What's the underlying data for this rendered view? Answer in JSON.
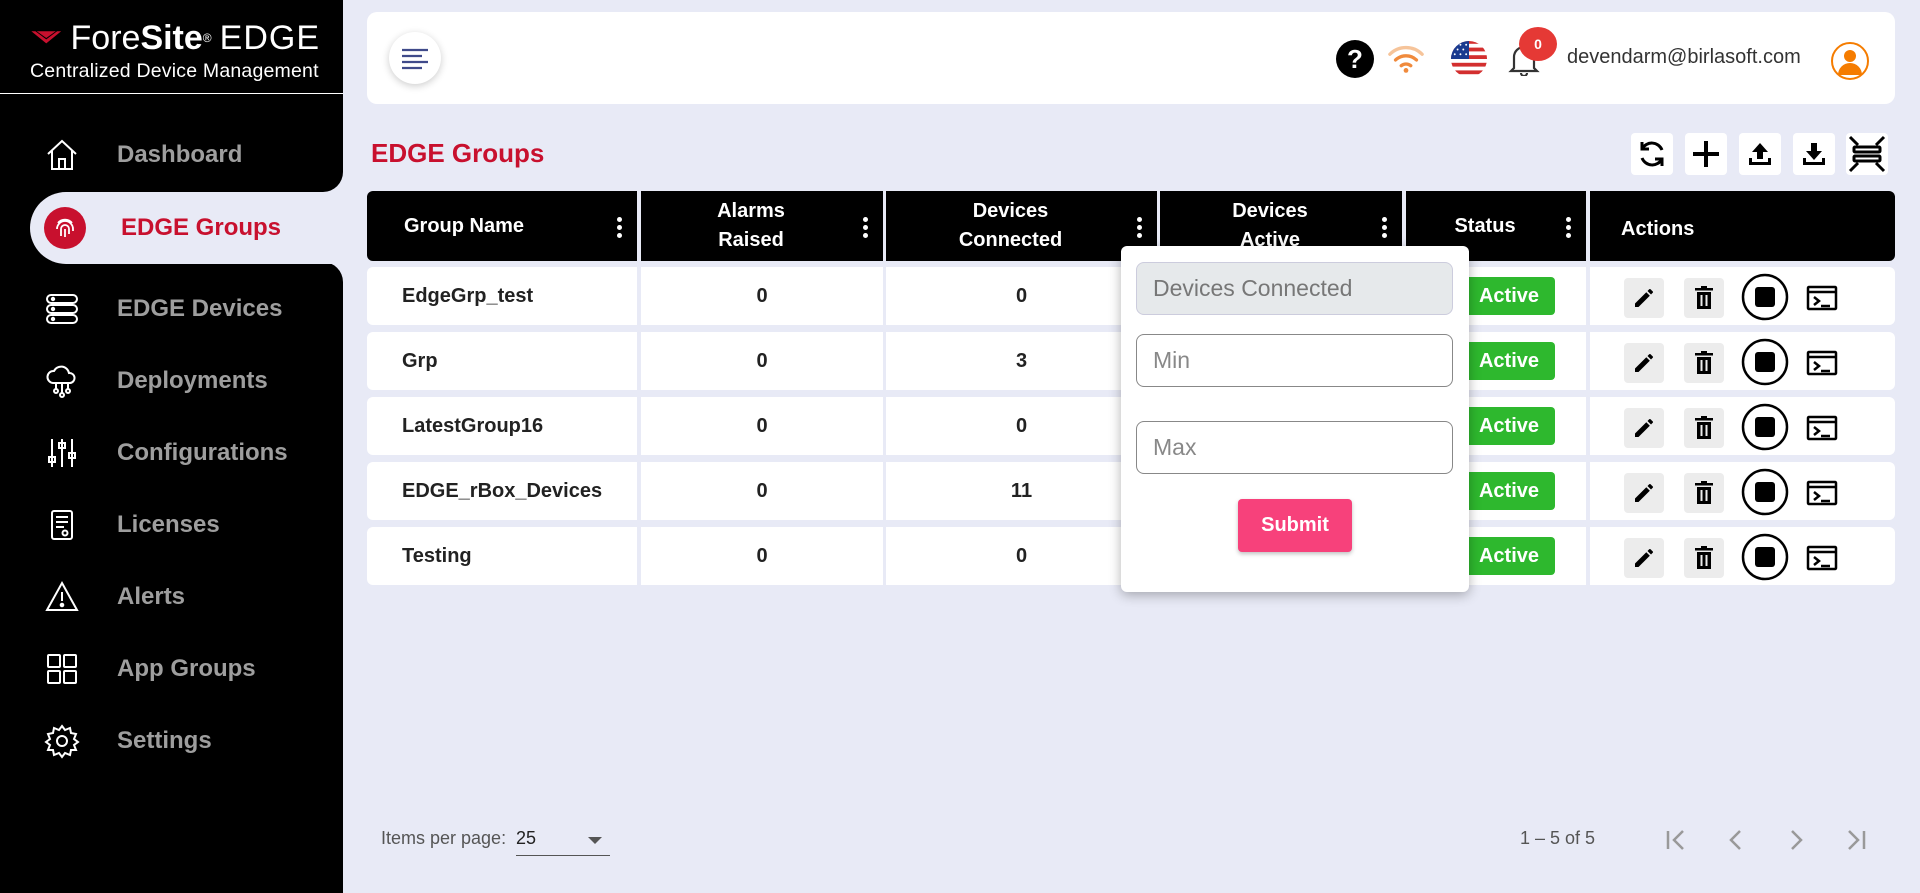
{
  "brand": {
    "name_part1": "Fore",
    "name_part2": "Site",
    "registered": "®",
    "name_part3": "EDGE",
    "subtitle": "Centralized Device Management",
    "accent_color": "#c8102e"
  },
  "sidebar": {
    "items": [
      {
        "label": "Dashboard",
        "icon": "home-icon"
      },
      {
        "label": "EDGE Groups",
        "icon": "fingerprint-icon",
        "active": true
      },
      {
        "label": "EDGE Devices",
        "icon": "server-icon"
      },
      {
        "label": "Deployments",
        "icon": "cloud-network-icon"
      },
      {
        "label": "Configurations",
        "icon": "sliders-icon"
      },
      {
        "label": "Licenses",
        "icon": "license-icon"
      },
      {
        "label": "Alerts",
        "icon": "warning-icon"
      },
      {
        "label": "App Groups",
        "icon": "grid-icon"
      },
      {
        "label": "Settings",
        "icon": "gear-icon"
      }
    ]
  },
  "header": {
    "help": "?",
    "notification_count": "0",
    "user_email": "devendarm@birlasoft.com"
  },
  "page": {
    "title": "EDGE Groups"
  },
  "toolbar": [
    "refresh-icon",
    "add-icon",
    "upload-icon",
    "download-icon",
    "collapse-icon"
  ],
  "table": {
    "columns": [
      "Group Name",
      "Alarms Raised",
      "Devices Connected",
      "Devices Active",
      "Status",
      "Actions"
    ],
    "column_lines": {
      "alarms": [
        "Alarms",
        "Raised"
      ],
      "connected": [
        "Devices",
        "Connected"
      ],
      "active": [
        "Devices",
        "Active"
      ]
    },
    "rows": [
      {
        "name": "EdgeGrp_test",
        "alarms": "0",
        "connected": "0",
        "status": "Active"
      },
      {
        "name": "Grp",
        "alarms": "0",
        "connected": "3",
        "status": "Active"
      },
      {
        "name": "LatestGroup16",
        "alarms": "0",
        "connected": "0",
        "status": "Active"
      },
      {
        "name": "EDGE_rBox_Devices",
        "alarms": "0",
        "connected": "11",
        "status": "Active"
      },
      {
        "name": "Testing",
        "alarms": "0",
        "connected": "0",
        "status": "Active"
      }
    ],
    "status_color": "#2eb82e"
  },
  "filter_popup": {
    "field_label": "Devices Connected",
    "min_placeholder": "Min",
    "max_placeholder": "Max",
    "submit_label": "Submit",
    "submit_color": "#f7417b"
  },
  "paginator": {
    "items_per_page_label": "Items per page:",
    "items_per_page": "25",
    "range": "1 – 5 of 5"
  }
}
